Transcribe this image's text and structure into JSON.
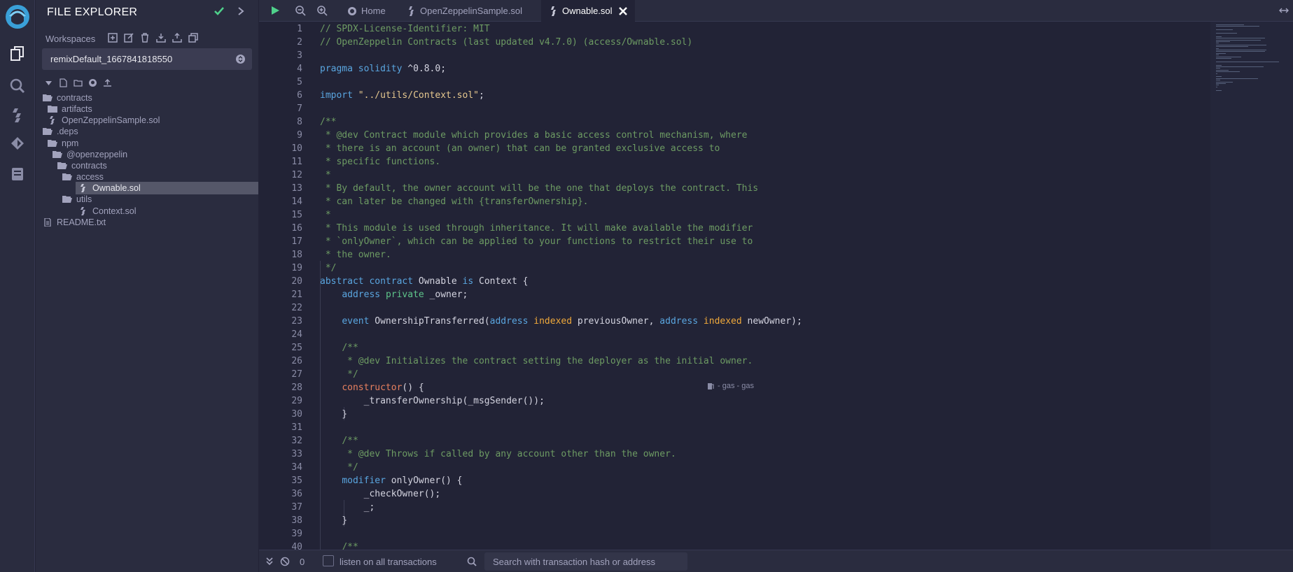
{
  "sidebar": {
    "title": "FILE EXPLORER",
    "workspaces_label": "Workspaces",
    "workspace_selected": "remixDefault_1667841818550",
    "tree": [
      {
        "label": "contracts",
        "icon": "folder-open-icon"
      },
      {
        "label": "artifacts",
        "icon": "folder-icon"
      },
      {
        "label": "OpenZeppelinSample.sol",
        "icon": "solidity-file-icon"
      },
      {
        "label": ".deps",
        "icon": "folder-open-icon"
      },
      {
        "label": "npm",
        "icon": "folder-open-icon"
      },
      {
        "label": "@openzeppelin",
        "icon": "folder-open-icon"
      },
      {
        "label": "contracts",
        "icon": "folder-open-icon"
      },
      {
        "label": "access",
        "icon": "folder-open-icon"
      },
      {
        "label": "Ownable.sol",
        "icon": "solidity-file-icon"
      },
      {
        "label": "utils",
        "icon": "folder-open-icon"
      },
      {
        "label": "Context.sol",
        "icon": "solidity-file-icon"
      },
      {
        "label": "README.txt",
        "icon": "text-file-icon"
      }
    ]
  },
  "tabs": [
    {
      "label": "Home",
      "icon": "remix-home-icon"
    },
    {
      "label": "OpenZeppelinSample.sol",
      "icon": "solidity-file-icon"
    },
    {
      "label": "Ownable.sol",
      "icon": "solidity-file-icon",
      "active": true
    }
  ],
  "editor": {
    "line_numbers": [
      "1",
      "2",
      "3",
      "4",
      "5",
      "6",
      "7",
      "8",
      "9",
      "10",
      "11",
      "12",
      "13",
      "14",
      "15",
      "16",
      "17",
      "18",
      "19",
      "20",
      "21",
      "22",
      "23",
      "24",
      "25",
      "26",
      "27",
      "28",
      "29",
      "30",
      "31",
      "32",
      "33",
      "34",
      "35",
      "36",
      "37",
      "38",
      "39",
      "40"
    ],
    "gas_hint": "- gas - gas"
  },
  "bottom": {
    "tx_count": "0",
    "listen_label": "listen on all transactions",
    "search_placeholder": "Search with transaction hash or address"
  },
  "colors": {
    "background": "#222336",
    "panel": "#2a2c3f",
    "accent_green": "#4fd18b",
    "comment": "#6d9b63",
    "keyword": "#5aa6e0"
  }
}
